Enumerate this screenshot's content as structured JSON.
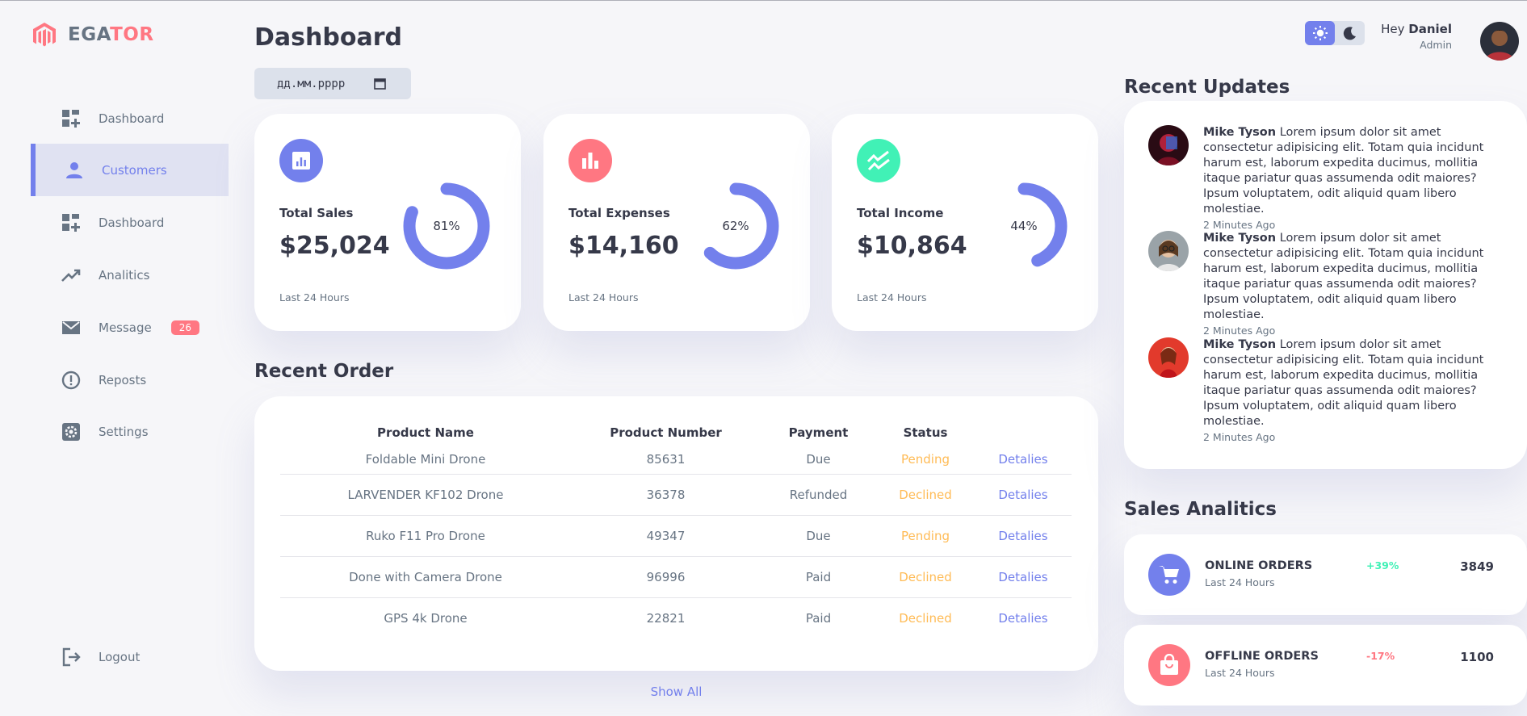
{
  "brand": {
    "prefix": "EGA",
    "accent_part": "TOR",
    "accent_color": "#ff7782"
  },
  "sidebar": {
    "items": [
      {
        "label": "Dashboard",
        "icon": "grid-plus-icon",
        "active": false
      },
      {
        "label": "Customers",
        "icon": "person-icon",
        "active": true
      },
      {
        "label": "Dashboard",
        "icon": "grid-plus-icon",
        "active": false
      },
      {
        "label": "Analitics",
        "icon": "trending-up-icon",
        "active": false
      },
      {
        "label": "Message",
        "icon": "mail-icon",
        "active": false,
        "badge": "26"
      },
      {
        "label": "Reposts",
        "icon": "alert-circle-icon",
        "active": false
      },
      {
        "label": "Settings",
        "icon": "gear-icon",
        "active": false
      }
    ],
    "logout": "Logout"
  },
  "header": {
    "title": "Dashboard",
    "date_placeholder": "дд.мм.рррр"
  },
  "cards": [
    {
      "label": "Total Sales",
      "amount": "$25,024",
      "percent": 81,
      "percent_label": "81%",
      "footer": "Last 24 Hours",
      "color": "#7380ec",
      "icon": "bar-chart-icon"
    },
    {
      "label": "Total Expenses",
      "amount": "$14,160",
      "percent": 62,
      "percent_label": "62%",
      "footer": "Last 24 Hours",
      "color": "#ff7782",
      "icon": "bar-chart-icon"
    },
    {
      "label": "Total Income",
      "amount": "$10,864",
      "percent": 44,
      "percent_label": "44%",
      "footer": "Last 24 Hours",
      "color": "#41f1b6",
      "icon": "trending-icon"
    }
  ],
  "recent_order": {
    "title": "Recent Order",
    "columns": [
      "Product Name",
      "Product Number",
      "Payment",
      "Status",
      ""
    ],
    "rows": [
      {
        "name": "Foldable Mini Drone",
        "number": "85631",
        "payment": "Due",
        "status": "Pending",
        "action": "Detalies"
      },
      {
        "name": "LARVENDER KF102 Drone",
        "number": "36378",
        "payment": "Refunded",
        "status": "Declined",
        "action": "Detalies"
      },
      {
        "name": "Ruko F11 Pro Drone",
        "number": "49347",
        "payment": "Due",
        "status": "Pending",
        "action": "Detalies"
      },
      {
        "name": "Done with Camera Drone",
        "number": "96996",
        "payment": "Paid",
        "status": "Declined",
        "action": "Detalies"
      },
      {
        "name": "GPS 4k Drone",
        "number": "22821",
        "payment": "Paid",
        "status": "Declined",
        "action": "Detalies"
      }
    ],
    "show_all": "Show All"
  },
  "profile": {
    "greeting": "Hey",
    "name": "Daniel",
    "role": "Admin"
  },
  "recent_updates": {
    "title": "Recent Updates",
    "items": [
      {
        "name": "Mike Tyson",
        "text": "Lorem ipsum dolor sit amet consectetur adipisicing elit. Totam quia incidunt harum est, laborum expedita ducimus, mollitia itaque pariatur quas assumenda odit maiores? Ipsum voluptatem, odit aliquid quam libero molestiae.",
        "time": "2 Minutes Ago"
      },
      {
        "name": "Mike Tyson",
        "text": "Lorem ipsum dolor sit amet consectetur adipisicing elit. Totam quia incidunt harum est, laborum expedita ducimus, mollitia itaque pariatur quas assumenda odit maiores? Ipsum voluptatem, odit aliquid quam libero molestiae.",
        "time": "2 Minutes Ago"
      },
      {
        "name": "Mike Tyson",
        "text": "Lorem ipsum dolor sit amet consectetur adipisicing elit. Totam quia incidunt harum est, laborum expedita ducimus, mollitia itaque pariatur quas assumenda odit maiores? Ipsum voluptatem, odit aliquid quam libero molestiae.",
        "time": "2 Minutes Ago"
      }
    ]
  },
  "sales_analytics": {
    "title": "Sales Analitics",
    "items": [
      {
        "name": "ONLINE ORDERS",
        "sub": "Last 24 Hours",
        "change": "+39%",
        "change_color": "#41f1b6",
        "value": "3849",
        "color": "#7380ec",
        "icon": "cart-icon"
      },
      {
        "name": "OFFLINE ORDERS",
        "sub": "Last 24 Hours",
        "change": "-17%",
        "change_color": "#ff7782",
        "value": "1100",
        "color": "#ff7782",
        "icon": "shopping-bag-icon"
      }
    ]
  },
  "colors": {
    "primary": "#7380ec",
    "danger": "#ff7782",
    "success": "#41f1b6",
    "warning": "#ffbb55"
  }
}
